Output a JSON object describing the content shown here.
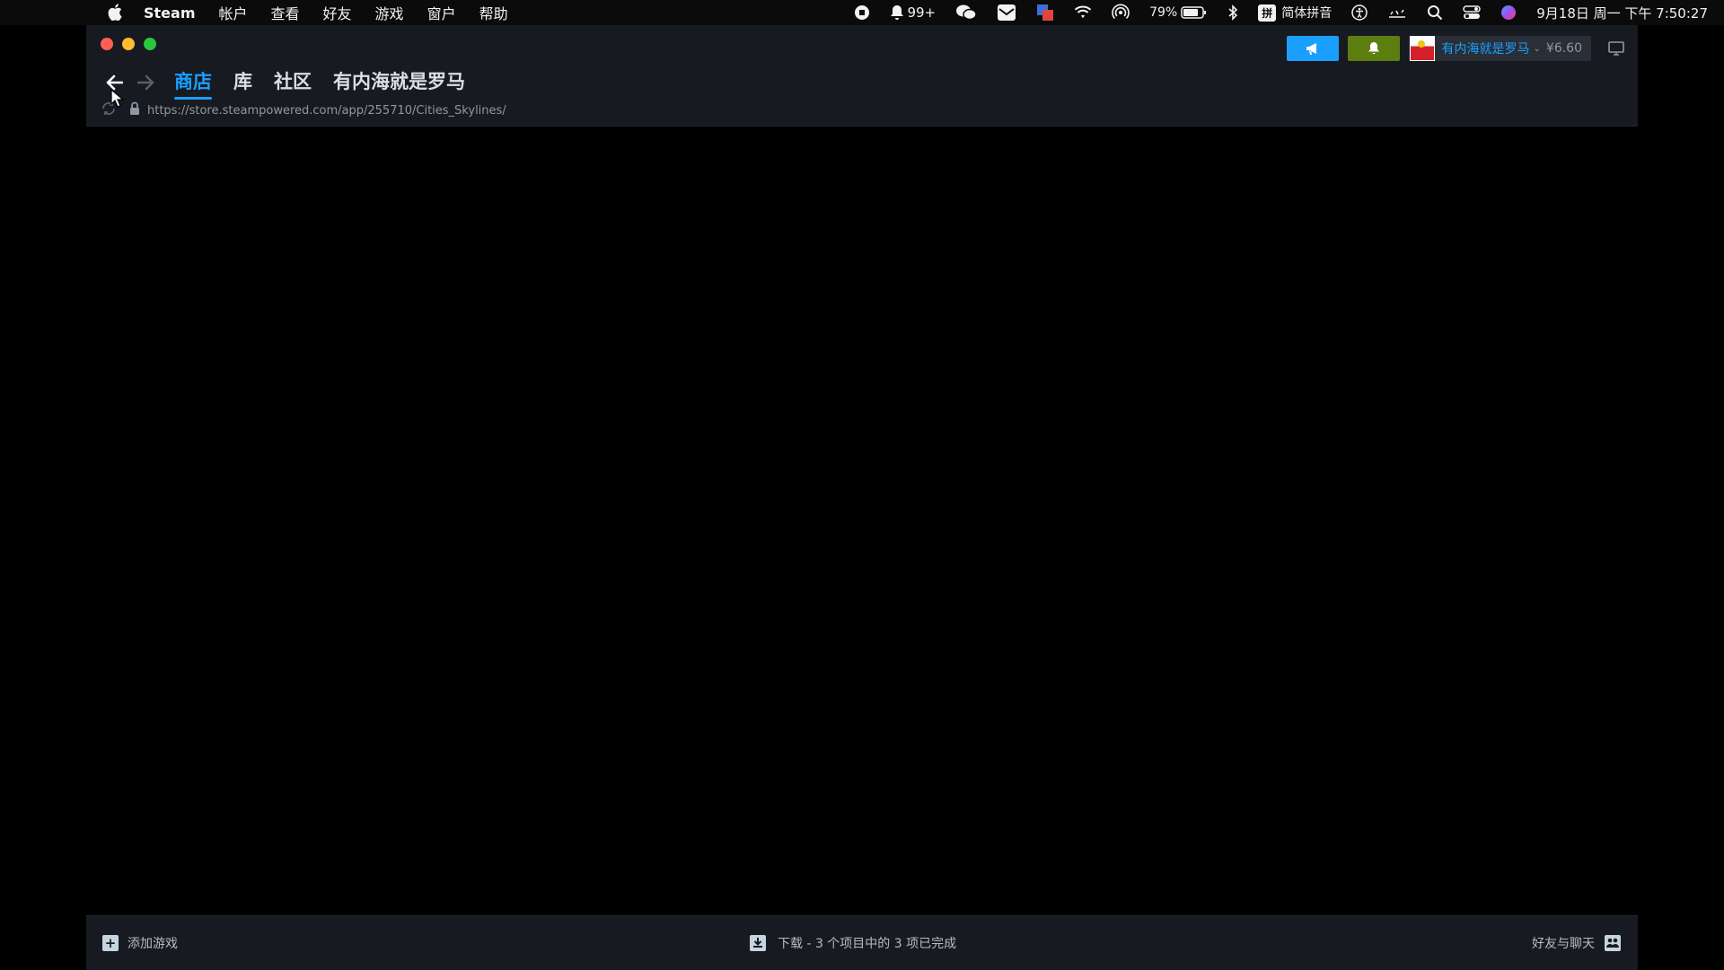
{
  "menubar": {
    "app": "Steam",
    "items": [
      "帐户",
      "查看",
      "好友",
      "游戏",
      "窗户",
      "帮助"
    ],
    "right": {
      "qq_count": "99+",
      "battery": "79%",
      "input_method": "简体拼音",
      "datetime": "9月18日 周一  下午 7:50:27"
    }
  },
  "steam": {
    "tabs": [
      "商店",
      "库",
      "社区",
      "有内海就是罗马"
    ],
    "url": "https://store.steampowered.com/app/255710/Cities_Skylines/",
    "account": {
      "name": "有内海就是罗马",
      "balance": "¥6.60"
    },
    "bottom": {
      "add_game": "添加游戏",
      "download_status": "下载 - 3 个项目中的 3 项已完成",
      "friends_chat": "好友与聊天"
    }
  },
  "colors": {
    "accent": "#1a9fff",
    "notify_green": "#5c7e10",
    "window_bg": "#171a21"
  }
}
